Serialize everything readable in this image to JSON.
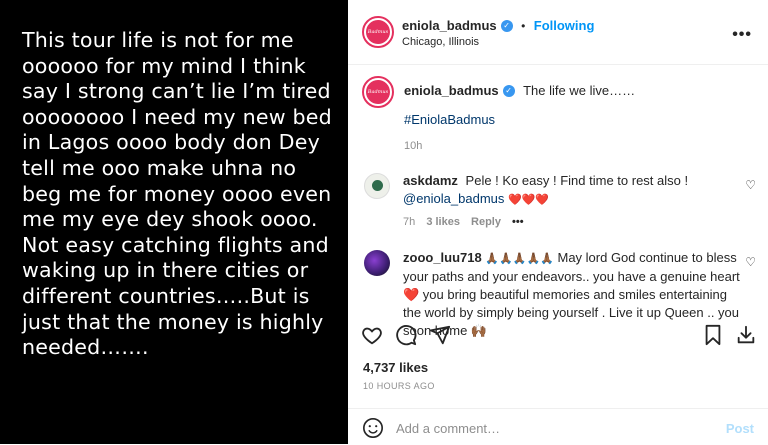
{
  "story": {
    "text": "This tour life is not for me oooooo for my mind I think say I strong can’t lie I’m tired oooooooo I need my new bed in Lagos oooo body don Dey tell me ooo make uhna no beg me for money oooo even me my eye dey shook oooo.\nNot easy catching flights and waking up in there cities or different countries…..But is just that the money is highly needed……."
  },
  "post": {
    "header": {
      "username": "eniola_badmus",
      "follow_separator": "•",
      "follow_label": "Following",
      "location": "Chicago, Illinois",
      "more_label": "•••"
    },
    "caption": {
      "username": "eniola_badmus",
      "text": "The life we live……",
      "hashtag": "#EniolaBadmus",
      "age": "10h"
    },
    "comments": [
      {
        "username": "askdamz",
        "line1": "Pele ! Ko easy ! Find time to rest also !",
        "mention": "@eniola_badmus",
        "emoji": "❤️❤️❤️",
        "age": "7h",
        "likes": "3 likes",
        "reply_label": "Reply",
        "more_label": "•••"
      },
      {
        "username": "zooo_luu718",
        "emoji_prefix": "🙏🏾🙏🏾🙏🏾🙏🏾🙏🏾",
        "text": "May lord God continue to bless your paths and your endeavors.. you have a genuine heart ❤️ you bring beautiful memories and smiles entertaining the world by simply being yourself . Live it up Queen .. you soon home 🙌🏾"
      }
    ],
    "likes_count": "4,737 likes",
    "timestamp": "10 HOURS AGO",
    "comment_placeholder": "Add a comment…",
    "post_label": "Post"
  },
  "colors": {
    "story_bg": "#000000",
    "accent_blue": "#0095f6",
    "verified_blue": "#3897f0",
    "ring": "#e4305e",
    "heart_red": "#ed4956"
  }
}
